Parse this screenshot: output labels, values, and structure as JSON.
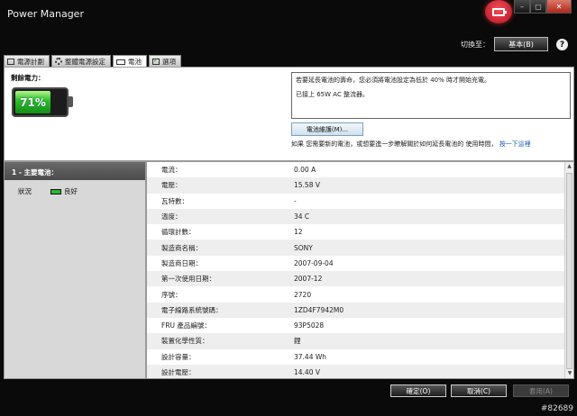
{
  "window": {
    "title": "Power Manager",
    "controls": [
      "–",
      "▢",
      "✕"
    ]
  },
  "header": {
    "switch_label": "切換至：",
    "switch_button": "基本(B)",
    "help": "?"
  },
  "tabs": [
    {
      "label": "電源計劃",
      "icon": "plan-icon"
    },
    {
      "label": "整體電源設定",
      "icon": "gear-icon"
    },
    {
      "label": "電池",
      "icon": "battery-icon",
      "active": true
    },
    {
      "label": "選項",
      "icon": "checkbox-icon"
    }
  ],
  "battery_overview": {
    "remaining_label": "剩餘電力：",
    "percent_text": "71%",
    "level": 0.71,
    "messages": [
      "若要延長電池的壽命，您必須將電池設定為低於 40% 時才開始充電。",
      "已接上 65W AC 整流器。"
    ],
    "info_button": "電池維護(M)...",
    "tip_text": "如果 您需要新的電池，或想要進一步瞭解關於如何延長電池的 使用時間，",
    "tip_link": "按一下這裡"
  },
  "left_panel": {
    "header": "1 - 主要電池：",
    "status_label": "狀況",
    "status_value": "良好"
  },
  "properties": [
    {
      "label": "電流：",
      "value": "0.00 A"
    },
    {
      "label": "電壓：",
      "value": "15.58 V"
    },
    {
      "label": "瓦特數：",
      "value": "-"
    },
    {
      "label": "溫度：",
      "value": "34 C"
    },
    {
      "label": "循環計數：",
      "value": "12"
    },
    {
      "label": "製造商名稱：",
      "value": "SONY"
    },
    {
      "label": "製造商日期：",
      "value": "2007-09-04"
    },
    {
      "label": "第一次使用日期：",
      "value": "2007-12"
    },
    {
      "label": "序號：",
      "value": "2720"
    },
    {
      "label": "電子線路系統號碼：",
      "value": "1ZD4F7942M0"
    },
    {
      "label": "FRU 產品編號：",
      "value": "93P5028"
    },
    {
      "label": "裝置化學性質：",
      "value": "鋰"
    },
    {
      "label": "設計容量：",
      "value": "37.44 Wh"
    },
    {
      "label": "設計電壓：",
      "value": "14.40 V"
    }
  ],
  "footer": {
    "ok": "確定(O)",
    "cancel": "取消(C)",
    "apply": "套用(A)"
  },
  "watermark": "#82689"
}
